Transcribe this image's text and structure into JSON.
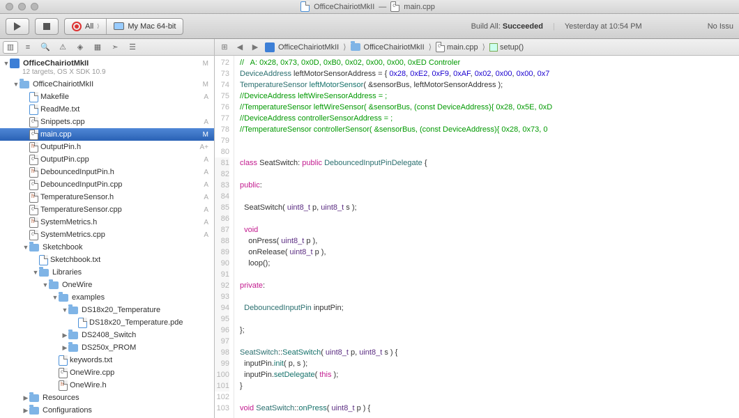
{
  "title": {
    "project": "OfficeChairiotMkII",
    "dash": "—",
    "file": "main.cpp"
  },
  "toolbar": {
    "scheme": "All",
    "dest": "My Mac 64-bit",
    "build": "Build All:",
    "result": "Succeeded",
    "when": "Yesterday at 10:54 PM",
    "issues": "No Issu"
  },
  "crumbs": {
    "c1": "OfficeChairiotMkII",
    "c2": "OfficeChairiotMkII",
    "c3": "main.cpp",
    "c4": "setup()"
  },
  "tree": {
    "root": "OfficeChairiotMkII",
    "rootsub": "12 targets, OS X SDK 10.9",
    "rootmark": "M",
    "n1": "OfficeChairiotMkII",
    "m1": "M",
    "f": [
      {
        "n": "Makefile",
        "m": "A",
        "t": "txt"
      },
      {
        "n": "ReadMe.txt",
        "m": "",
        "t": "txt"
      },
      {
        "n": "Snippets.cpp",
        "m": "A",
        "t": "c"
      },
      {
        "n": "main.cpp",
        "m": "M",
        "t": "c",
        "sel": true
      },
      {
        "n": "OutputPin.h",
        "m": "A+",
        "t": "h"
      },
      {
        "n": "OutputPin.cpp",
        "m": "A",
        "t": "c"
      },
      {
        "n": "DebouncedInputPin.h",
        "m": "A",
        "t": "h"
      },
      {
        "n": "DebouncedInputPin.cpp",
        "m": "A",
        "t": "c"
      },
      {
        "n": "TemperatureSensor.h",
        "m": "A",
        "t": "h"
      },
      {
        "n": "TemperatureSensor.cpp",
        "m": "A",
        "t": "c"
      },
      {
        "n": "SystemMetrics.h",
        "m": "A",
        "t": "h"
      },
      {
        "n": "SystemMetrics.cpp",
        "m": "A",
        "t": "c"
      }
    ],
    "sk": "Sketchbook",
    "skf": "Sketchbook.txt",
    "lib": "Libraries",
    "ow": "OneWire",
    "ex": "examples",
    "d1": "DS18x20_Temperature",
    "d1f": "DS18x20_Temperature.pde",
    "d2": "DS2408_Switch",
    "d3": "DS250x_PROM",
    "kw": "keywords.txt",
    "owc": "OneWire.cpp",
    "owh": "OneWire.h",
    "res": "Resources",
    "cfg": "Configurations"
  }
}
